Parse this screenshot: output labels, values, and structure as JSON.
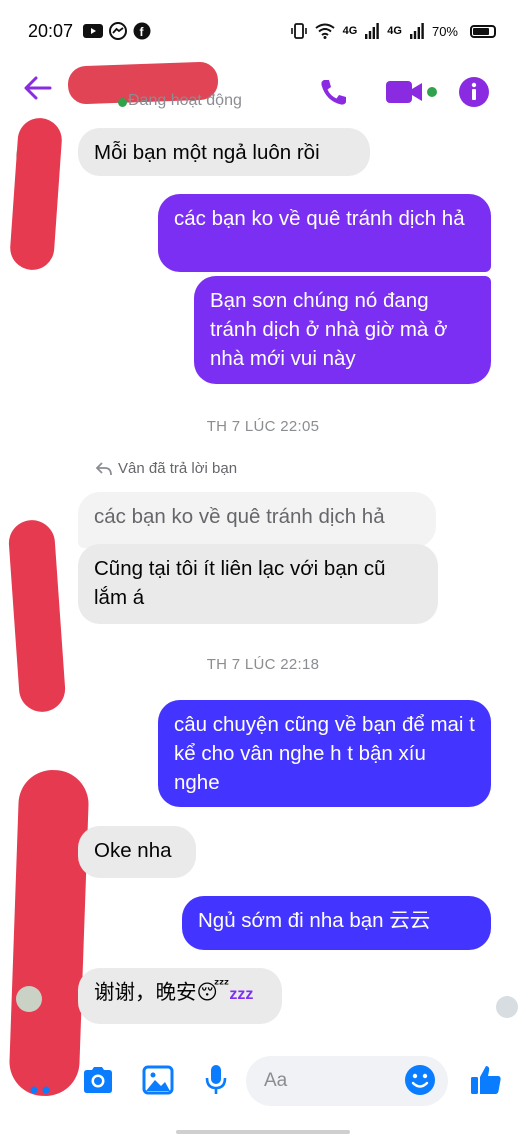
{
  "status_bar": {
    "time": "20:07",
    "network_1": "4G",
    "network_2": "4G",
    "battery": "70%"
  },
  "header": {
    "status": "Đang hoạt động",
    "accent_color": "#8a2be2"
  },
  "messages": [
    {
      "dir": "in",
      "text": "Mỗi bạn một ngả luôn rồi"
    },
    {
      "dir": "out",
      "text": "các bạn ko về quê tránh dịch hả"
    },
    {
      "dir": "out",
      "text": "Bạn sơn chúng nó đang tránh dịch ở nhà giờ mà ở nhà mới vui này"
    },
    {
      "dir": "in",
      "text": "Cũng tại tôi ít liên lạc với bạn cũ lắm á"
    },
    {
      "dir": "out",
      "text": "câu chuyện cũng về bạn để mai t kể cho vân nghe h t bận xíu nghe"
    },
    {
      "dir": "in",
      "text": "Oke nha"
    },
    {
      "dir": "out",
      "text": "Ngủ sớm đi nha bạn 云云"
    },
    {
      "dir": "in",
      "text": "谢谢，晚安😴"
    }
  ],
  "timestamps": [
    "TH 7 LÚC 22:05",
    "TH 7 LÚC 22:18"
  ],
  "reply": {
    "note": "Vân đã trả lời bạn",
    "quoted": "các bạn ko về quê tránh dịch hả"
  },
  "composer": {
    "placeholder": "Aa"
  }
}
